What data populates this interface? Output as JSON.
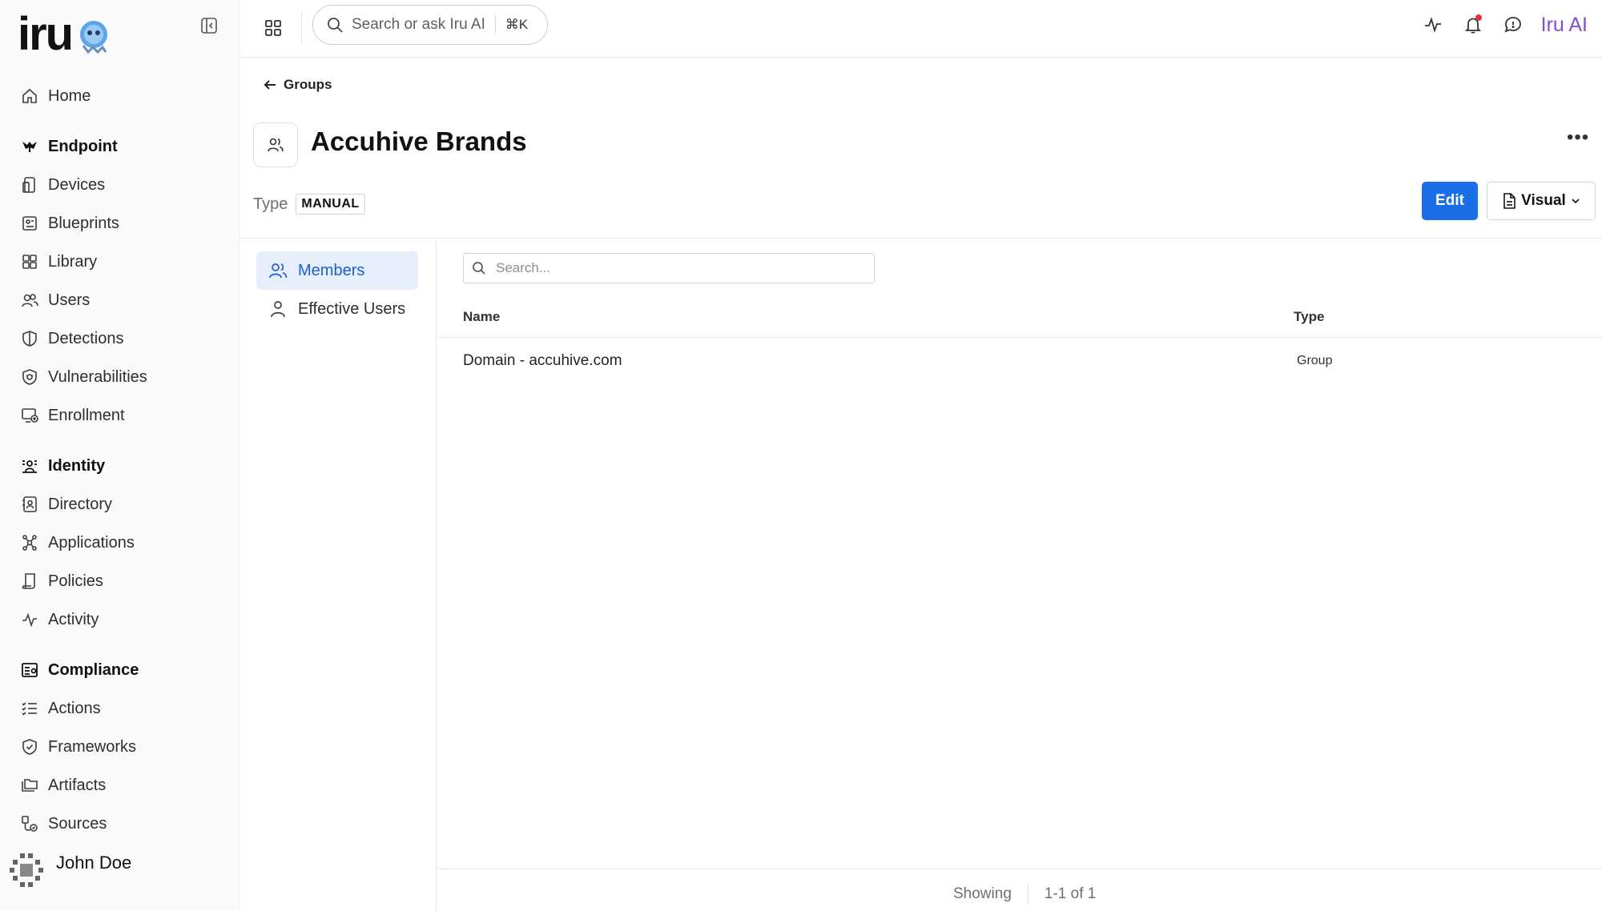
{
  "app": {
    "brand": "iru",
    "ai_label": "Iru AI"
  },
  "search": {
    "label": "Search or ask Iru AI",
    "shortcut": "⌘K"
  },
  "sidebar": {
    "items_top": [
      {
        "label": "Home",
        "icon": "home-icon"
      }
    ],
    "sections": [
      {
        "title": "Endpoint",
        "icon": "endpoint-icon",
        "items": [
          {
            "label": "Devices",
            "icon": "device-icon"
          },
          {
            "label": "Blueprints",
            "icon": "blueprint-icon"
          },
          {
            "label": "Library",
            "icon": "library-icon"
          },
          {
            "label": "Users",
            "icon": "users-icon"
          },
          {
            "label": "Detections",
            "icon": "shield-icon"
          },
          {
            "label": "Vulnerabilities",
            "icon": "bug-shield-icon"
          },
          {
            "label": "Enrollment",
            "icon": "enrollment-icon"
          }
        ]
      },
      {
        "title": "Identity",
        "icon": "identity-icon",
        "items": [
          {
            "label": "Directory",
            "icon": "directory-icon"
          },
          {
            "label": "Applications",
            "icon": "applications-icon"
          },
          {
            "label": "Policies",
            "icon": "policies-icon"
          },
          {
            "label": "Activity",
            "icon": "activity-icon"
          }
        ]
      },
      {
        "title": "Compliance",
        "icon": "compliance-icon",
        "items": [
          {
            "label": "Actions",
            "icon": "checklist-icon"
          },
          {
            "label": "Frameworks",
            "icon": "shield-check-icon"
          },
          {
            "label": "Artifacts",
            "icon": "folder-icon"
          },
          {
            "label": "Sources",
            "icon": "sources-icon"
          }
        ]
      }
    ],
    "user": {
      "name": "John Doe"
    }
  },
  "header": {
    "back_label": "Groups",
    "title": "Accuhive Brands",
    "type_label": "Type",
    "type_value": "MANUAL",
    "edit_label": "Edit",
    "visual_label": "Visual"
  },
  "subnav": {
    "items": [
      {
        "label": "Members",
        "active": true
      },
      {
        "label": "Effective Users",
        "active": false
      }
    ]
  },
  "table": {
    "search_placeholder": "Search...",
    "columns": [
      "Name",
      "Type"
    ],
    "rows": [
      {
        "name": "Domain - accuhive.com",
        "type": "Group"
      }
    ]
  },
  "footer": {
    "showing_label": "Showing",
    "range": "1-1 of 1"
  },
  "colors": {
    "accent": "#1a6ee8",
    "ai": "#7b52d6",
    "active_bg": "#e7eefb"
  }
}
